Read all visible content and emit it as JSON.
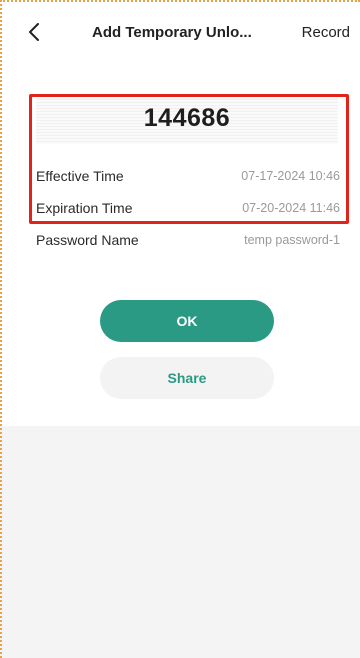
{
  "header": {
    "title": "Add Temporary Unlo...",
    "record_label": "Record"
  },
  "password": {
    "code": "144686",
    "rows": [
      {
        "label": "Effective Time",
        "value": "07-17-2024 10:46"
      },
      {
        "label": "Expiration Time",
        "value": "07-20-2024 11:46"
      },
      {
        "label": "Password Name",
        "value": "temp password-1"
      }
    ]
  },
  "actions": {
    "ok_label": "OK",
    "share_label": "Share"
  },
  "colors": {
    "accent": "#2a9a84",
    "highlight": "#e2231a"
  },
  "icons": {
    "back": "chevron-left-icon"
  }
}
